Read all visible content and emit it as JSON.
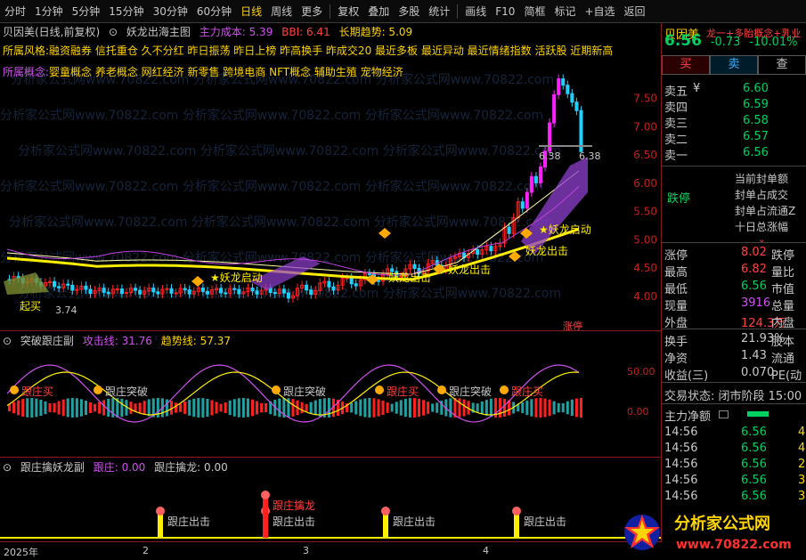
{
  "toolbar": {
    "items": [
      "分时",
      "1分钟",
      "5分钟",
      "15分钟",
      "30分钟",
      "60分钟",
      "日线",
      "周线",
      "更多",
      "复权",
      "叠加",
      "多股",
      "统计",
      "画线",
      "F10",
      "简框",
      "标记",
      "+自选",
      "返回"
    ],
    "active_index": 6
  },
  "main_chart": {
    "stock_name": "贝因美(日线,前复权)",
    "formula_name": "妖龙出海主图",
    "cost_label": "主力成本: 5.39",
    "bbi_label": "BBI: 6.41",
    "trend_label": "长期趋势: 5.09",
    "tags_line": "所属风格:融资融券 信托重仓 久不分红 昨日振荡 昨日上榜 昨高换手 昨成交20 最近多板 最近异动 最近情绪指数 活跃股 近期新高",
    "concept_label": "所属概念:",
    "concept_text": "婴童概念 养老概念 网红经济 新零售 跨境电商 NFT概念 辅助生殖 宠物经济",
    "price_ticks": [
      "7.50",
      "7.00",
      "6.50",
      "6.00",
      "5.50",
      "5.00",
      "4.50",
      "4.00"
    ],
    "annotations": {
      "low_label": "3.74",
      "high_left": "6.38",
      "high_right": "6.38",
      "yaolong_out_1": "妖龙出击",
      "yaolong_out_2": "妖龙出击",
      "yaolong_start": "★妖龙启动",
      "yaolong_out_3": "妖龙出击",
      "early_buy": "起买",
      "long_start_left": "★妖龙启动",
      "limit_tag": "涨停"
    },
    "colors": {
      "up": "#ff2020",
      "down": "#20d0ff",
      "limitup": "#ff20ff",
      "fan": "#b040e0",
      "yellow": "#ffee00"
    }
  },
  "sub1": {
    "name": "突破跟庄副",
    "attack_label": "攻击线: 31.76",
    "trend_label": "趋势线: 57.37",
    "ticks": [
      "50.00",
      "0.00"
    ],
    "labels": [
      "跟庄买",
      "跟庄突破",
      "跟庄突破",
      "跟庄买",
      "跟庄突破",
      "跟庄买"
    ]
  },
  "sub2": {
    "name": "跟庄擒妖龙副",
    "zhuang_label": "跟庄: 0.00",
    "qinlong_label": "跟庄擒龙: 0.00",
    "labels": [
      "跟庄出击",
      "跟庄出击",
      "跟庄擒龙",
      "跟庄出击",
      "跟庄出击"
    ]
  },
  "time_axis": [
    "2025年",
    "2",
    "3",
    "4"
  ],
  "watermark": "分析家公式网www.70822.com",
  "right_panel": {
    "name": "贝因美",
    "concept_tag": "龙一+多胎概念+乳业",
    "price": "6.56",
    "change": "-0.73",
    "change_pct": "-10.01%",
    "buttons": [
      "买",
      "卖",
      "查"
    ],
    "asks": [
      {
        "name": "卖五",
        "price": "6.60",
        "mark": "¥"
      },
      {
        "name": "卖四",
        "price": "6.59"
      },
      {
        "name": "卖三",
        "price": "6.58"
      },
      {
        "name": "卖二",
        "price": "6.57"
      },
      {
        "name": "卖一",
        "price": "6.56"
      }
    ],
    "limit_status": "跌停",
    "seal_lines": [
      "当前封单额",
      "封单占成交",
      "封单占流通Z",
      "十日总涨幅"
    ],
    "stats": [
      {
        "k": "涨停",
        "v": "8.02",
        "k2": "跌停"
      },
      {
        "k": "最高",
        "v": "6.82",
        "k2": "量比"
      },
      {
        "k": "最低",
        "v": "6.56",
        "k2": "市值"
      },
      {
        "k": "现量",
        "v": "3916",
        "k2": "总量"
      },
      {
        "k": "外盘",
        "v": "124.3万",
        "k2": "内盘"
      }
    ],
    "stats2": [
      {
        "k": "换手",
        "v": "21.93%",
        "k2": "股本"
      },
      {
        "k": "净资",
        "v": "1.43",
        "k2": "流通"
      },
      {
        "k": "收益(三)",
        "v": "0.070",
        "k2": "PE(动"
      }
    ],
    "trade_status": "交易状态: 闭市阶段 15:00",
    "net_flow_label": "主力净额",
    "trades": [
      {
        "t": "14:56",
        "p": "6.56",
        "q": "4"
      },
      {
        "t": "14:56",
        "p": "6.56",
        "q": "4"
      },
      {
        "t": "14:56",
        "p": "6.56",
        "q": "2"
      },
      {
        "t": "14:56",
        "p": "6.56",
        "q": "3"
      },
      {
        "t": "14:56",
        "p": "6.56",
        "q": "3"
      }
    ]
  },
  "logo": {
    "text": "分析家公式网",
    "url": "www.70822.com"
  }
}
